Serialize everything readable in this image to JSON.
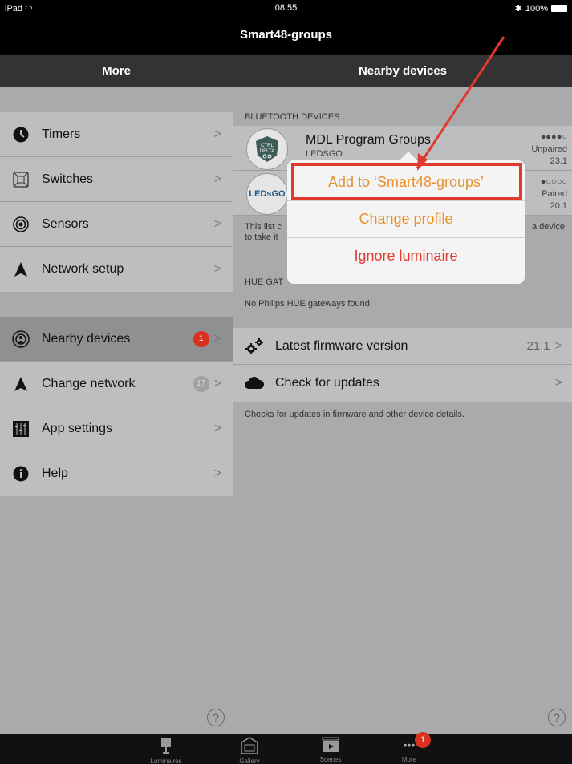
{
  "status_bar": {
    "device": "iPad",
    "time": "08:55",
    "battery": "100%"
  },
  "title": "Smart48-groups",
  "left_header": "More",
  "right_header": "Nearby devices",
  "menu_group_1": [
    {
      "label": "Timers",
      "icon": "clock-icon"
    },
    {
      "label": "Switches",
      "icon": "switch-icon"
    },
    {
      "label": "Sensors",
      "icon": "sensor-icon"
    },
    {
      "label": "Network setup",
      "icon": "network-icon"
    }
  ],
  "menu_group_2": [
    {
      "label": "Nearby devices",
      "icon": "nearby-icon",
      "badge": "1",
      "badge_color": "red"
    },
    {
      "label": "Change network",
      "icon": "network-icon",
      "badge": "17",
      "badge_color": "gray"
    },
    {
      "label": "App settings",
      "icon": "sliders-icon"
    },
    {
      "label": "Help",
      "icon": "info-icon"
    }
  ],
  "help_symbol": "?",
  "bluetooth_section": "BLUETOOTH DEVICES",
  "devices": [
    {
      "name": "MDL Program Groups",
      "vendor": "LEDSGO",
      "signal": "●●●●○",
      "pair_status": "Unpaired",
      "version": "23.1",
      "logo_text": "CTRL DELTA"
    },
    {
      "name": "",
      "vendor": "",
      "signal": "●○○○○",
      "pair_status": "Paired",
      "version": "20.1",
      "logo_text": "LEDsGO"
    }
  ],
  "info_text_left_1": "This list c",
  "info_text_left_2": "to take it",
  "info_text_right": "a device",
  "hue_section": "HUE GAT",
  "hue_text": "No Philips HUE gateways found.",
  "firmware": {
    "label": "Latest firmware version",
    "value": "21.1"
  },
  "updates": {
    "label": "Check for updates"
  },
  "updates_note": "Checks for updates in firmware and other device details.",
  "popover": {
    "items": [
      {
        "label": "Add to ‘Smart48-groups’",
        "color": "orange"
      },
      {
        "label": "Change profile",
        "color": "orange"
      },
      {
        "label": "Ignore luminaire",
        "color": "red"
      }
    ]
  },
  "tabbar": {
    "items": [
      {
        "label": "Luminaires",
        "icon": "lamp-icon"
      },
      {
        "label": "Gallery",
        "icon": "gallery-icon"
      },
      {
        "label": "Scenes",
        "icon": "clapper-icon"
      },
      {
        "label": "More",
        "icon": "more-icon",
        "badge": "1"
      }
    ]
  },
  "colors": {
    "accent_orange": "#e8912b",
    "accent_red": "#e03a2e",
    "badge_red": "#d9311f"
  }
}
